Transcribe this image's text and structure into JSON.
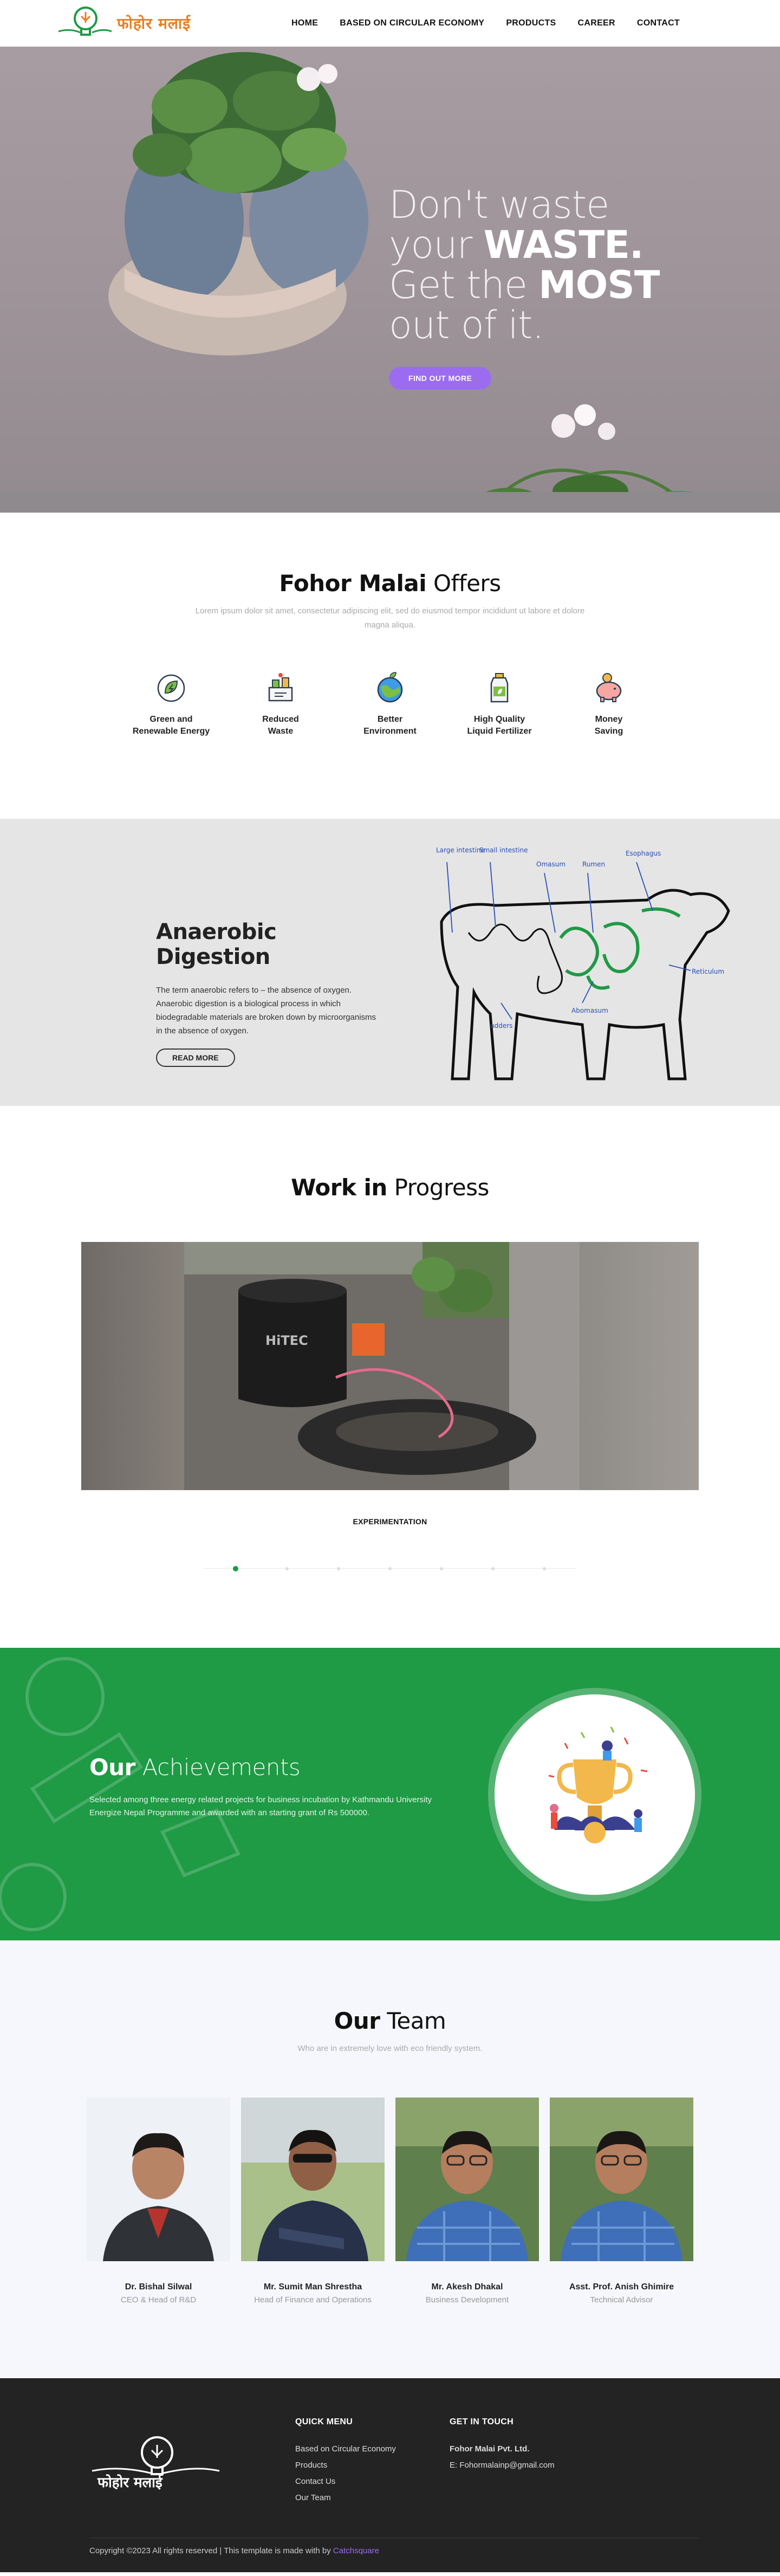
{
  "brand": {
    "logo_text": "फोहोर मलाई",
    "colors": {
      "green": "#1f9a45",
      "orange": "#e67e22",
      "purple": "#9b6cf0",
      "dark": "#232323"
    }
  },
  "nav": {
    "items": [
      {
        "label": "HOME"
      },
      {
        "label": "BASED ON CIRCULAR ECONOMY"
      },
      {
        "label": "PRODUCTS"
      },
      {
        "label": "CAREER"
      },
      {
        "label": "CONTACT"
      }
    ]
  },
  "hero": {
    "line1": "Don't waste",
    "line2_pre": "your ",
    "line2_bold": "WASTE.",
    "line3_pre": "Get the ",
    "line3_bold": "MOST",
    "line4": "out of it.",
    "button": "FIND OUT MORE"
  },
  "offers": {
    "title_bold": "Fohor Malai",
    "title_rest": " Offers",
    "description": "Lorem ipsum dolor sit amet, consectetur adipiscing elit, sed do eiusmod tempor incididunt ut labore et dolore magna aliqua.",
    "items": [
      {
        "icon": "leaf-energy-icon",
        "line1": "Green and",
        "line2": "Renewable Energy"
      },
      {
        "icon": "waste-reduction-icon",
        "line1": "Reduced",
        "line2": "Waste"
      },
      {
        "icon": "globe-environment-icon",
        "line1": "Better",
        "line2": "Environment"
      },
      {
        "icon": "fertilizer-bottle-icon",
        "line1": "High Quality",
        "line2": "Liquid Fertilizer"
      },
      {
        "icon": "piggy-bank-icon",
        "line1": "Money",
        "line2": "Saving"
      }
    ]
  },
  "anaerobic": {
    "title_bold": "Anaerobic",
    "title_rest": " Digestion",
    "body": "The term anaerobic refers to – the absence of oxygen. Anaerobic digestion is a biological process in which biodegradable materials are broken down by microorganisms in the absence of oxygen.",
    "button": "READ MORE",
    "diagram_labels": [
      "Large intestine",
      "Small intestine",
      "Omasum",
      "Rumen",
      "Esophagus",
      "Reticulum",
      "Abomasum",
      "udders"
    ]
  },
  "wip": {
    "title_bold": "Work in",
    "title_rest": " Progress",
    "caption": "EXPERIMENTATION",
    "dots_total": 7,
    "active_index": 0,
    "equipment_label": "HiTEC"
  },
  "achievements": {
    "title_bold": "Our",
    "title_rest": " Achievements",
    "body": "Selected among three energy related projects for business incubation by Kathmandu University Energize Nepal Programme and awarded with an starting grant of Rs 500000."
  },
  "team": {
    "title_bold": "Our",
    "title_rest": " Team",
    "subtitle": "Who are in extremely love with eco friendly system.",
    "members": [
      {
        "name": "Dr. Bishal Silwal",
        "role": "CEO & Head of R&D"
      },
      {
        "name": "Mr. Sumit Man Shrestha",
        "role": "Head of Finance and Operations"
      },
      {
        "name": "Mr. Akesh Dhakal",
        "role": "Business Development"
      },
      {
        "name": "Asst. Prof. Anish Ghimire",
        "role": "Technical Advisor"
      }
    ]
  },
  "footer": {
    "quick_menu_title": "QUICK MENU",
    "quick_menu": [
      "Based on Circular Economy",
      "Products",
      "Contact Us",
      "Our Team"
    ],
    "contact_title": "GET IN TOUCH",
    "company": "Fohor Malai Pvt. Ltd.",
    "email": "E: Fohormalainp@gmail.com",
    "copyright": "Copyright ©2023 All rights reserved | This template is made with by ",
    "credit": "Catchsquare"
  }
}
